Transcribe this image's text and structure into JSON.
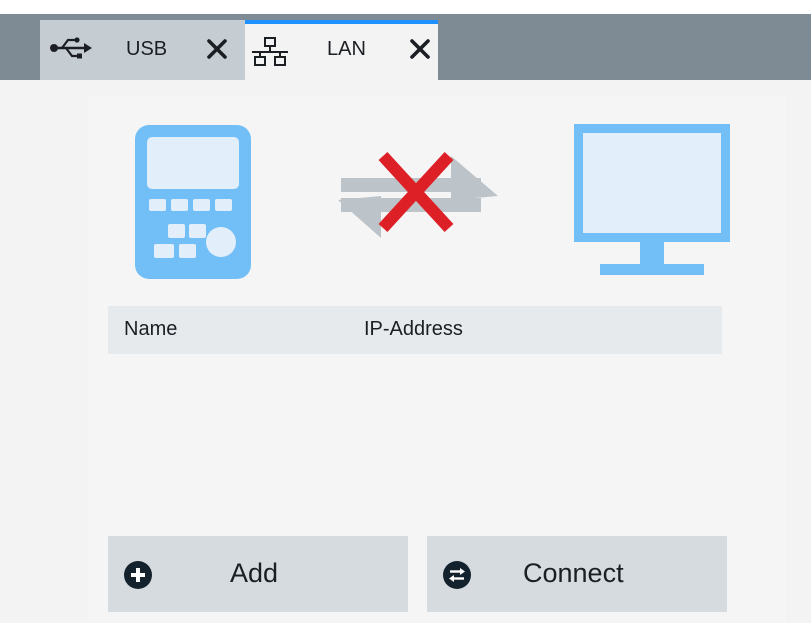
{
  "tabs": [
    {
      "label": "USB",
      "icon": "usb-icon",
      "active": false
    },
    {
      "label": "LAN",
      "icon": "network-icon",
      "active": true
    }
  ],
  "status": {
    "device_icon": "handheld-instrument-icon",
    "connection_icon": "disconnected-icon",
    "host_icon": "monitor-icon"
  },
  "table": {
    "columns": [
      "Name",
      "IP-Address"
    ],
    "rows": []
  },
  "buttons": {
    "add": {
      "label": "Add",
      "icon": "plus-circle-icon"
    },
    "connect": {
      "label": "Connect",
      "icon": "swap-circle-icon"
    }
  },
  "colors": {
    "tabbar": "#7f8b94",
    "active_tab_accent": "#1e90ff",
    "device_blue": "#72bff7",
    "disconnect_red": "#dd2026",
    "button_bg": "#d6dbdf",
    "icon_dark": "#14222e"
  }
}
